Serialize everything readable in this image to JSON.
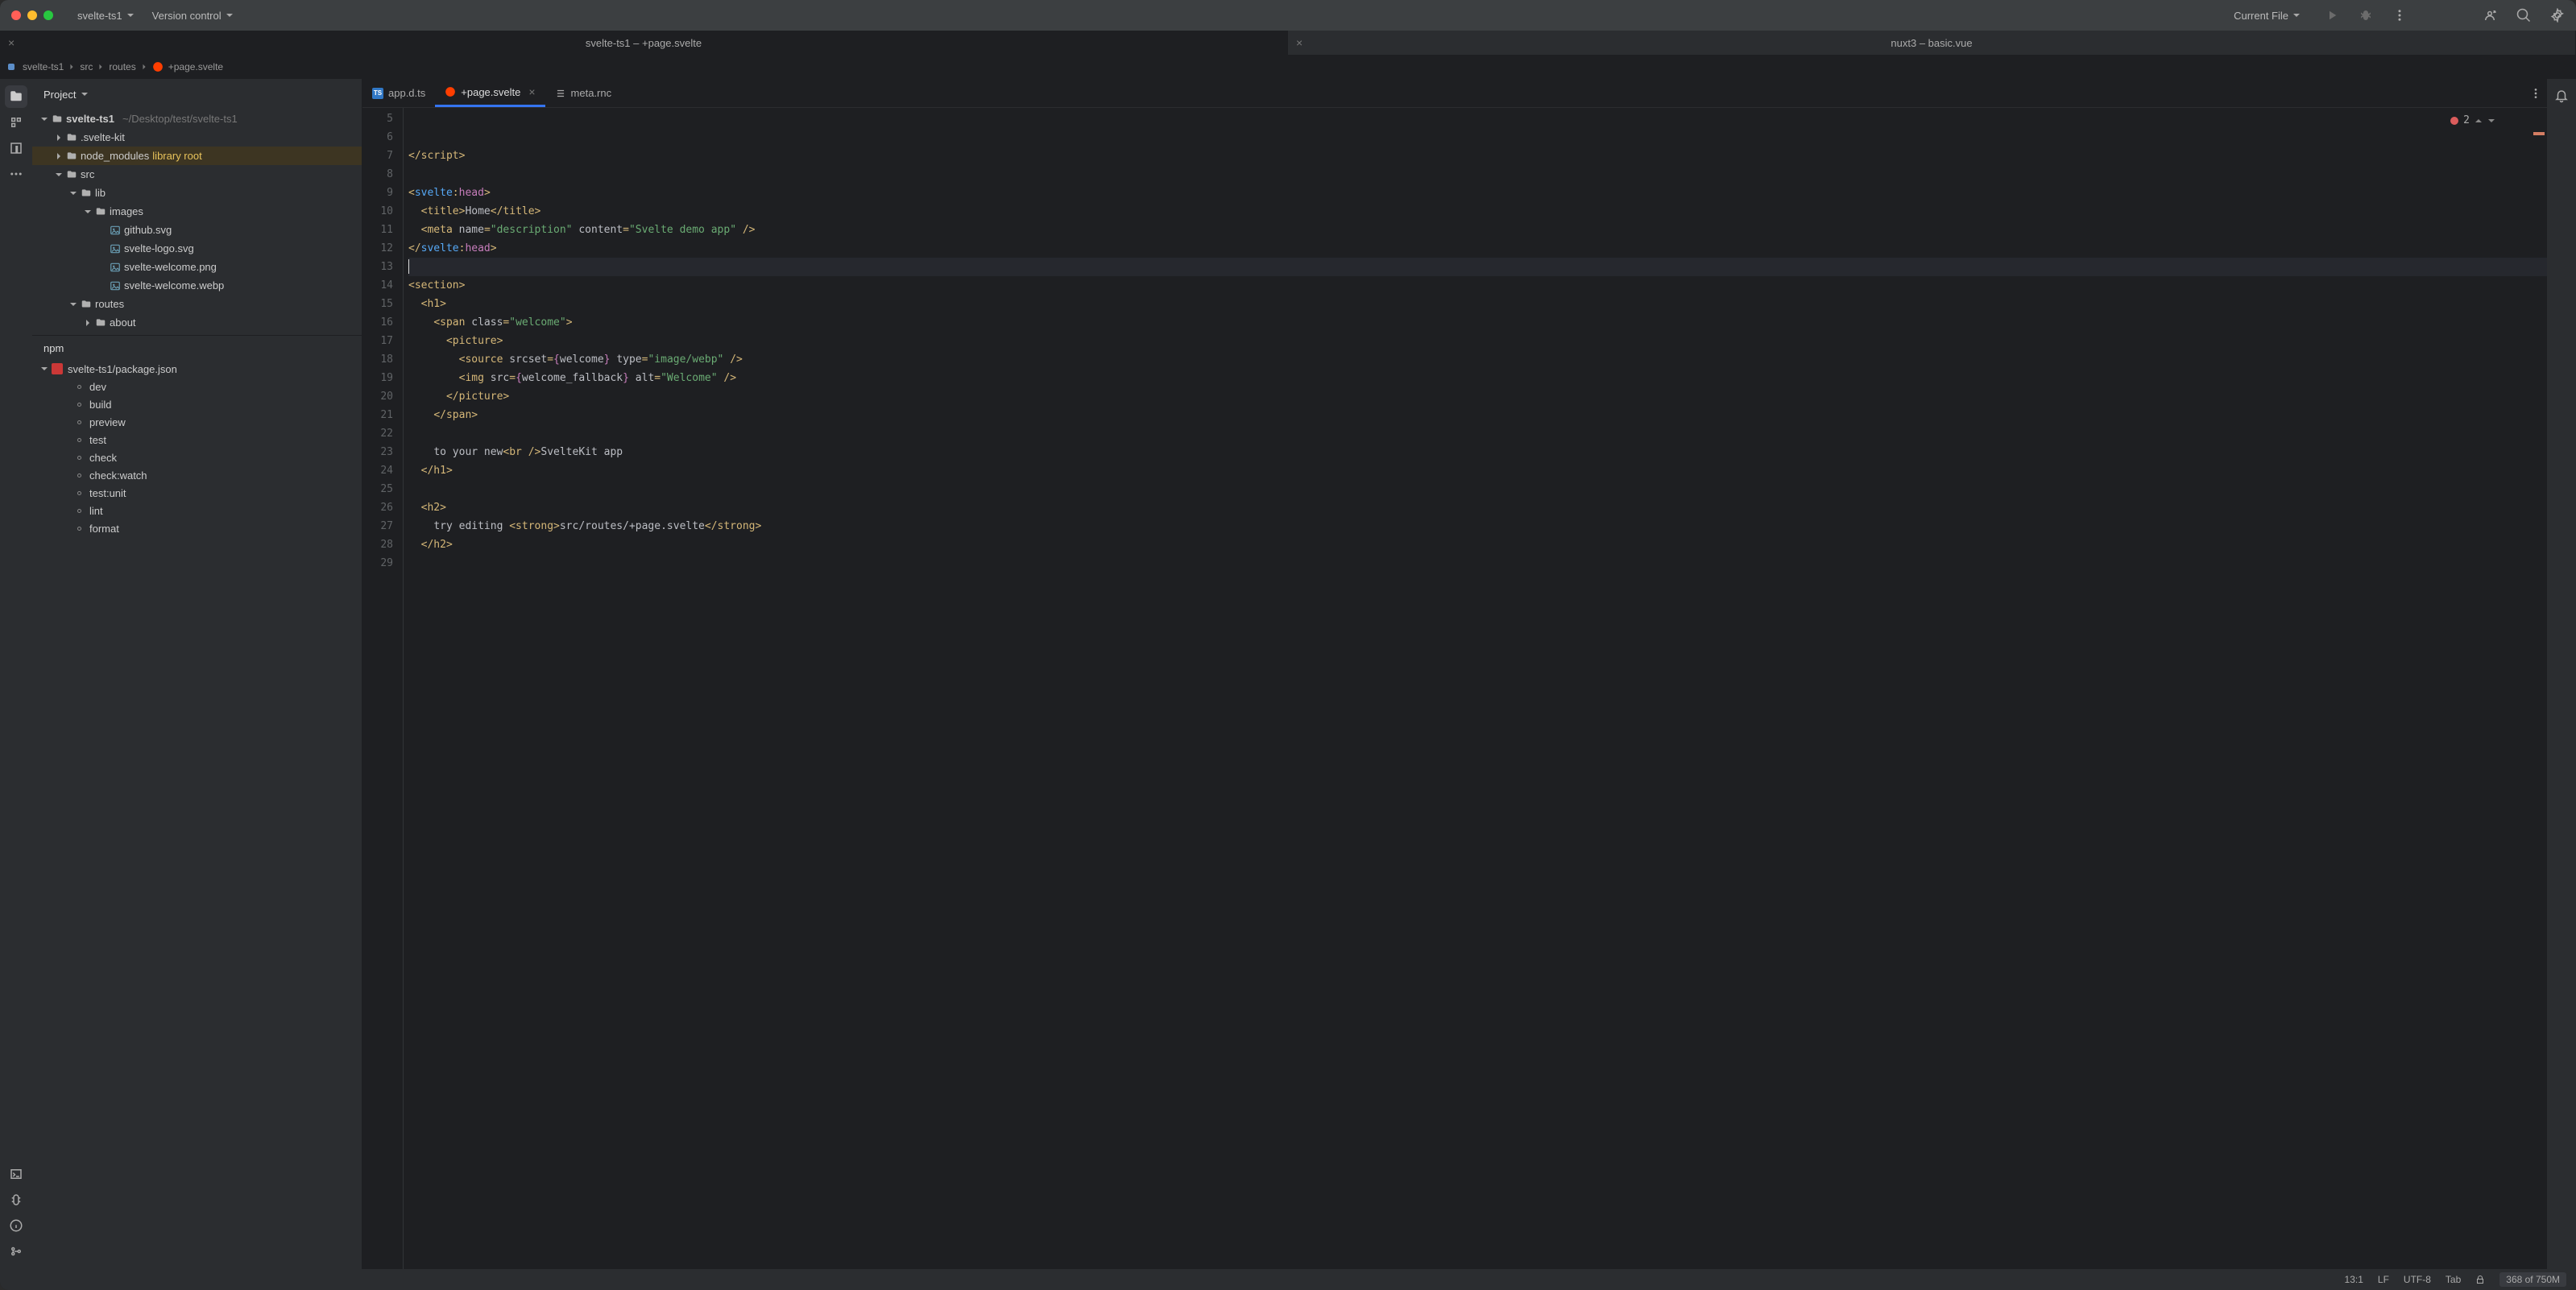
{
  "titlebar": {
    "project_name": "svelte-ts1",
    "vcs_label": "Version control",
    "run_config": "Current File"
  },
  "project_tabs": [
    {
      "label": "svelte-ts1 – +page.svelte",
      "active": true
    },
    {
      "label": "nuxt3 – basic.vue",
      "active": false
    }
  ],
  "breadcrumb": {
    "parts": [
      "svelte-ts1",
      "src",
      "routes"
    ],
    "file": "+page.svelte"
  },
  "sidebar": {
    "title": "Project",
    "tree": [
      {
        "depth": 0,
        "expand": "open",
        "icon": "folder",
        "label": "svelte-ts1",
        "suffix": "~/Desktop/test/svelte-ts1",
        "bold": true
      },
      {
        "depth": 1,
        "expand": "closed",
        "icon": "folder",
        "label": ".svelte-kit"
      },
      {
        "depth": 1,
        "expand": "closed",
        "icon": "folder",
        "label": "node_modules",
        "suffix": "library root",
        "suffix_class": "lib-root",
        "selected": true
      },
      {
        "depth": 1,
        "expand": "open",
        "icon": "folder",
        "label": "src"
      },
      {
        "depth": 2,
        "expand": "open",
        "icon": "folder",
        "label": "lib"
      },
      {
        "depth": 3,
        "expand": "open",
        "icon": "folder",
        "label": "images"
      },
      {
        "depth": 4,
        "expand": "none",
        "icon": "image",
        "label": "github.svg"
      },
      {
        "depth": 4,
        "expand": "none",
        "icon": "image",
        "label": "svelte-logo.svg"
      },
      {
        "depth": 4,
        "expand": "none",
        "icon": "image",
        "label": "svelte-welcome.png"
      },
      {
        "depth": 4,
        "expand": "none",
        "icon": "image",
        "label": "svelte-welcome.webp"
      },
      {
        "depth": 2,
        "expand": "open",
        "icon": "folder",
        "label": "routes"
      },
      {
        "depth": 3,
        "expand": "closed",
        "icon": "folder",
        "label": "about"
      }
    ]
  },
  "npm": {
    "title": "npm",
    "package": "svelte-ts1/package.json",
    "scripts": [
      "dev",
      "build",
      "preview",
      "test",
      "check",
      "check:watch",
      "test:unit",
      "lint",
      "format"
    ]
  },
  "editor_tabs": [
    {
      "label": "app.d.ts",
      "active": false,
      "icon": "ts",
      "closable": false
    },
    {
      "label": "+page.svelte",
      "active": true,
      "icon": "svelte",
      "closable": true
    },
    {
      "label": "meta.rnc",
      "active": false,
      "icon": "list",
      "closable": false
    }
  ],
  "editor": {
    "error_count": "2",
    "gutter_start": 5,
    "gutter_end": 29,
    "lines": [
      {
        "n": 5,
        "html": ""
      },
      {
        "n": 6,
        "html": ""
      },
      {
        "n": 7,
        "html": "<span class='c-tag'>&lt;/script&gt;</span>"
      },
      {
        "n": 8,
        "html": ""
      },
      {
        "n": 9,
        "html": "<span class='c-tag'>&lt;</span><span class='c-svtag'>svelte</span><span class='c-tag'>:</span><span class='c-svdir'>head</span><span class='c-tag'>&gt;</span>"
      },
      {
        "n": 10,
        "html": "  <span class='c-tag'>&lt;title&gt;</span><span class='c-txt'>Home</span><span class='c-tag'>&lt;/title&gt;</span>"
      },
      {
        "n": 11,
        "html": "  <span class='c-tag'>&lt;meta </span><span class='c-attr'>name</span><span class='c-tag'>=</span><span class='c-str'>\"description\"</span> <span class='c-attr'>content</span><span class='c-tag'>=</span><span class='c-str'>\"Svelte demo app\"</span><span class='c-tag'> /&gt;</span>"
      },
      {
        "n": 12,
        "html": "<span class='c-tag'>&lt;/</span><span class='c-svtag'>svelte</span><span class='c-tag'>:</span><span class='c-svdir'>head</span><span class='c-tag'>&gt;</span>"
      },
      {
        "n": 13,
        "html": "",
        "cursor": true,
        "hl": true
      },
      {
        "n": 14,
        "html": "<span class='c-tag'>&lt;section&gt;</span>"
      },
      {
        "n": 15,
        "html": "  <span class='c-tag'>&lt;h1&gt;</span>"
      },
      {
        "n": 16,
        "html": "    <span class='c-tag'>&lt;span </span><span class='c-attr'>class</span><span class='c-tag'>=</span><span class='c-str'>\"welcome\"</span><span class='c-tag'>&gt;</span>"
      },
      {
        "n": 17,
        "html": "      <span class='c-tag'>&lt;picture&gt;</span>"
      },
      {
        "n": 18,
        "html": "        <span class='c-tag'>&lt;source </span><span class='c-attr'>srcset</span><span class='c-tag'>=</span><span class='c-expr'>{</span><span class='c-txt'>welcome</span><span class='c-expr'>}</span> <span class='c-attr'>type</span><span class='c-tag'>=</span><span class='c-str'>\"image/webp\"</span><span class='c-tag'> /&gt;</span>"
      },
      {
        "n": 19,
        "html": "        <span class='c-tag'>&lt;img </span><span class='c-attr'>src</span><span class='c-tag'>=</span><span class='c-expr'>{</span><span class='c-txt'>welcome_fallback</span><span class='c-expr'>}</span> <span class='c-attr'>alt</span><span class='c-tag'>=</span><span class='c-str'>\"Welcome\"</span><span class='c-tag'> /&gt;</span>"
      },
      {
        "n": 20,
        "html": "      <span class='c-tag'>&lt;/picture&gt;</span>"
      },
      {
        "n": 21,
        "html": "    <span class='c-tag'>&lt;/span&gt;</span>"
      },
      {
        "n": 22,
        "html": ""
      },
      {
        "n": 23,
        "html": "    <span class='c-txt'>to your new</span><span class='c-tag'>&lt;br /&gt;</span><span class='c-txt'>SvelteKit app</span>"
      },
      {
        "n": 24,
        "html": "  <span class='c-tag'>&lt;/h1&gt;</span>"
      },
      {
        "n": 25,
        "html": ""
      },
      {
        "n": 26,
        "html": "  <span class='c-tag'>&lt;h2&gt;</span>"
      },
      {
        "n": 27,
        "html": "    <span class='c-txt'>try editing </span><span class='c-tag'>&lt;strong&gt;</span><span class='c-txt'>src/routes/+page.svelte</span><span class='c-tag'>&lt;/strong&gt;</span>"
      },
      {
        "n": 28,
        "html": "  <span class='c-tag'>&lt;/h2&gt;</span>"
      },
      {
        "n": 29,
        "html": ""
      }
    ]
  },
  "status": {
    "caret": "13:1",
    "line_ending": "LF",
    "encoding": "UTF-8",
    "indent": "Tab",
    "memory": "368 of 750M"
  }
}
